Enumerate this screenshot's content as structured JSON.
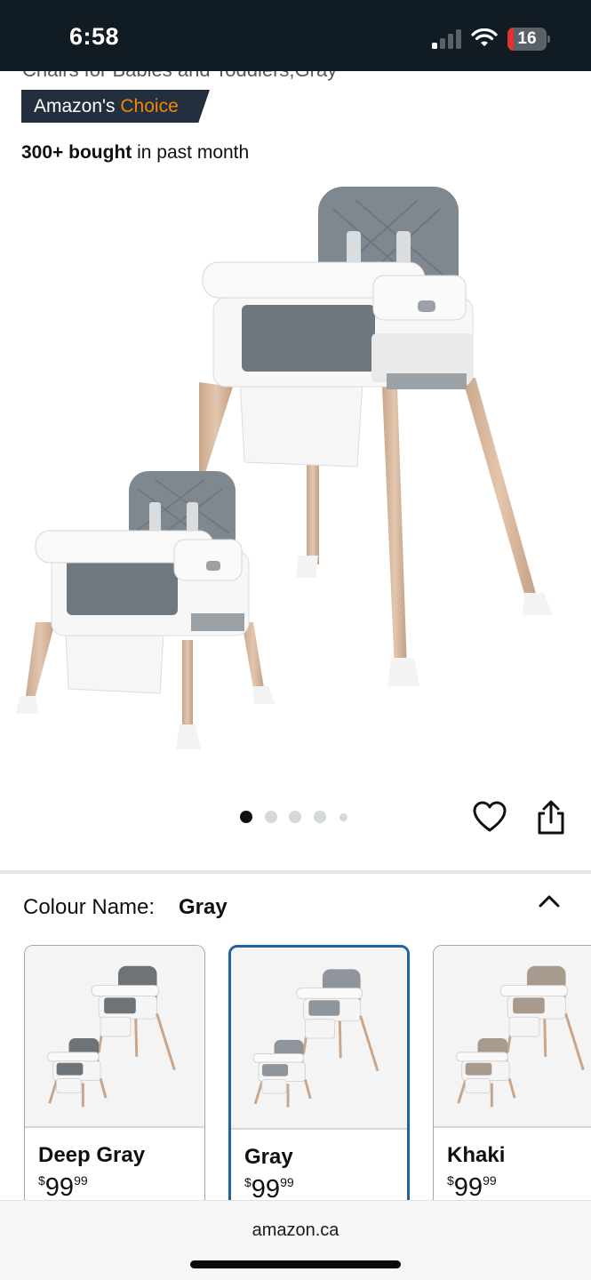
{
  "status_bar": {
    "time": "6:58",
    "battery": "16",
    "battery_level": 0.16,
    "icons": [
      "signal-icon",
      "wifi-icon",
      "battery-icon"
    ]
  },
  "product": {
    "title_partial": "Chairs for Babies and Toddlers,Gray",
    "badge": {
      "prefix": "Amazon's",
      "highlight": "Choice"
    },
    "bought": {
      "strong": "300+ bought",
      "rest": "in past month"
    }
  },
  "carousel": {
    "dot_count": 5,
    "active_index": 0
  },
  "actions": {
    "icons": [
      "heart-icon",
      "share-icon"
    ]
  },
  "colour": {
    "label": "Colour Name:",
    "selected": "Gray",
    "options": [
      {
        "name": "Deep Gray",
        "symbol": "$",
        "whole": "99",
        "fraction": "99",
        "seat_color": "#6e7378",
        "selected": false
      },
      {
        "name": "Gray",
        "symbol": "$",
        "whole": "99",
        "fraction": "99",
        "seat_color": "#8e959c",
        "selected": true
      },
      {
        "name": "Khaki",
        "symbol": "$",
        "whole": "99",
        "fraction": "99",
        "seat_color": "#a89a8c",
        "selected": false
      }
    ]
  },
  "browser": {
    "url": "amazon.ca"
  },
  "colors": {
    "badge_bg": "#232f3e",
    "choice_orange": "#f08804",
    "selected_border": "#2162a1",
    "status_bar": "#111b23"
  }
}
